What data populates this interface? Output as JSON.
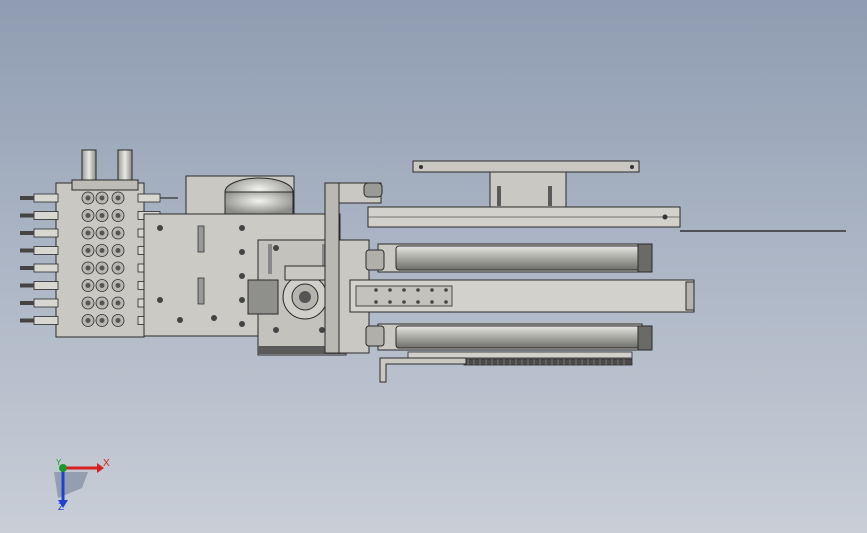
{
  "viewport": {
    "background_top": "#8f9cb1",
    "background_bottom": "#c9ced7",
    "model": {
      "part_color": "#c9c8c3",
      "edge_color": "#2a2a2a",
      "dark_color": "#5a5a5a",
      "valve_count": 8,
      "cylinder_count": 2
    },
    "triad": {
      "x_label": "X",
      "y_label": "Y",
      "z_label": "Z",
      "x_color": "#d62020",
      "y_color": "#1a9a2a",
      "z_color": "#2040d0"
    }
  }
}
